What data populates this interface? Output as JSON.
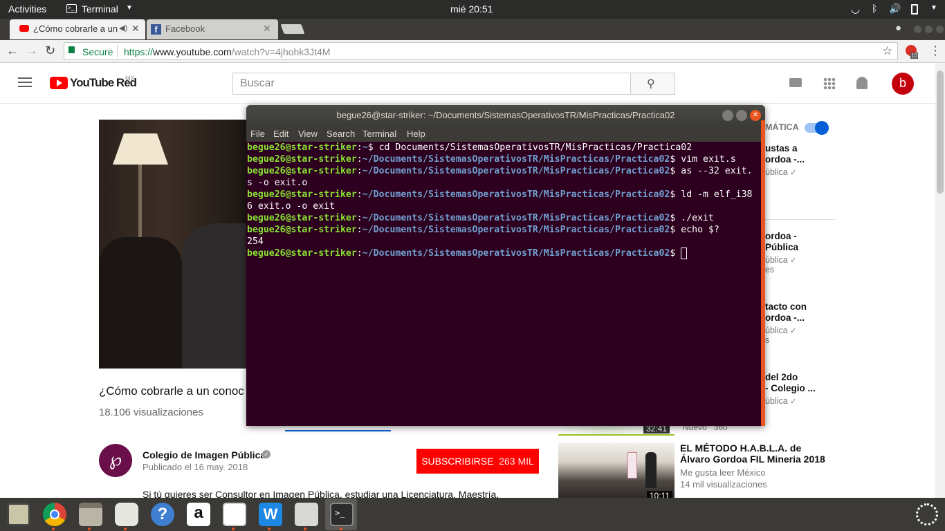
{
  "topbar": {
    "activities": "Activities",
    "app": "Terminal",
    "clock": "mié 20:51"
  },
  "browser": {
    "tabs": [
      {
        "title": "¿Cómo cobrarle a un"
      },
      {
        "title": "Facebook"
      }
    ],
    "secure_label": "Secure",
    "url_scheme": "https://",
    "url_host": "www.youtube.com",
    "url_path": "/watch?v=4jhohk3Jt4M",
    "ext_badge": "10"
  },
  "youtube": {
    "logo_text": "YouTube Red",
    "logo_region": "MX",
    "search_placeholder": "Buscar",
    "avatar_letter": "b",
    "autoplay_label": "MÁTICA",
    "video_title": "¿Cómo cobrarle a un conoc",
    "views": "18.106 visualizaciones",
    "channel_name": "Colegio de Imagen Pública",
    "published": "Publicado el 16 may. 2018",
    "subscribe_label": "SUBSCRIBIRSE",
    "subscribe_count": "263 MIL",
    "description": "Si tú quieres ser Consultor en Imagen Pública, estudiar una Licenciatura, Maestría,",
    "related": [
      {
        "l1": "ustas a",
        "l2": "ordoa -...",
        "l3": "ública"
      },
      {
        "l1": "ordoa -",
        "l2": "Pública",
        "l3": "ública",
        "l4": "es"
      },
      {
        "l1": "tacto con",
        "l2": "ordoa -...",
        "l3": "ública",
        "l4": "s"
      },
      {
        "l1": "del 2do",
        "l2": "- Colegio ...",
        "l3": "ública"
      }
    ],
    "partial_meta": "Nuevo   360",
    "partial_duration": "32:41",
    "last_related": {
      "title1": "EL MÉTODO H.A.B.L.A. de",
      "title2": "Álvaro Gordoa FIL Minería 2018",
      "channel": "Me gusta leer México",
      "views": "14 mil visualizaciones",
      "duration": "10:11"
    }
  },
  "terminal": {
    "title": "begue26@star-striker: ~/Documents/SistemasOperativosTR/MisPracticas/Practica02",
    "menu": [
      "File",
      "Edit",
      "View",
      "Search",
      "Terminal",
      "Help"
    ],
    "user": "begue26@star-striker",
    "path": "~/Documents/SistemasOperativosTR/MisPracticas/Practica02",
    "lines": [
      {
        "path": "~",
        "cmd": "$ cd Documents/SistemasOperativosTR/MisPracticas/Practica02"
      },
      {
        "path": "~/Documents/SistemasOperativosTR/MisPracticas/Practica02",
        "cmd": "$ vim exit.s"
      },
      {
        "path": "~/Documents/SistemasOperativosTR/MisPracticas/Practica02",
        "cmd": "$ as --32 exit."
      },
      {
        "text": "s -o exit.o"
      },
      {
        "path": "~/Documents/SistemasOperativosTR/MisPracticas/Practica02",
        "cmd": "$ ld -m elf_i38"
      },
      {
        "text": "6 exit.o -o exit"
      },
      {
        "path": "~/Documents/SistemasOperativosTR/MisPracticas/Practica02",
        "cmd": "$ ./exit"
      },
      {
        "path": "~/Documents/SistemasOperativosTR/MisPracticas/Practica02",
        "cmd": "$ echo $?"
      },
      {
        "text": "254"
      },
      {
        "path": "~/Documents/SistemasOperativosTR/MisPracticas/Practica02",
        "cmd": "$ "
      }
    ]
  },
  "colors": {
    "ubuntu_orange": "#e95420",
    "terminal_bg": "#2c001e",
    "yt_red": "#ff0000"
  }
}
